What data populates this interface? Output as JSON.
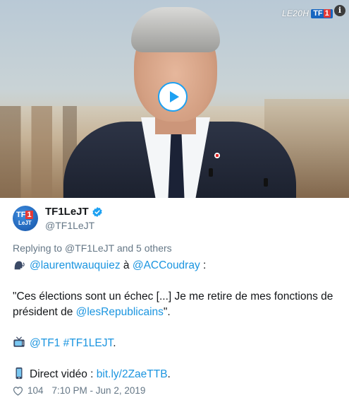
{
  "media": {
    "tv_show_label": "LE20H",
    "tv_brand_prefix": "TF",
    "tv_brand_one": "1",
    "info_label": "i",
    "play_icon": "play-icon",
    "accent": "#1da1f2"
  },
  "avatar": {
    "top_text": "TF",
    "one_text": "1",
    "bottom_text": "LeJT"
  },
  "author": {
    "display_name": "TF1LeJT",
    "handle": "@TF1LeJT",
    "verified_icon": "verified-badge-icon"
  },
  "reply": {
    "prefix": "Replying to",
    "to_handle": "@TF1LeJT",
    "others": "and 5 others"
  },
  "tweet": {
    "line1": {
      "emoji": "speaking-head-icon",
      "mention1": "@laurentwauquiez",
      "connector": " à ",
      "mention2": "@ACCoudray",
      "suffix": " :"
    },
    "quote": {
      "part1": "\"Ces élections sont un échec [...] Je me retire de mes fonctions de président de ",
      "mention": "@lesRepublicains",
      "part2": "\"."
    },
    "tv_line": {
      "emoji": "television-icon",
      "mention": "@TF1",
      "hashtag": "#TF1LEJT",
      "suffix": "."
    },
    "video_line": {
      "emoji": "mobile-phone-icon",
      "label": "Direct vidéo : ",
      "link": "bit.ly/2ZaeTTB",
      "suffix": "."
    }
  },
  "footer": {
    "likes": "104",
    "timestamp": "7:10 PM - Jun 2, 2019"
  },
  "colors": {
    "link": "#1b95e0",
    "secondary": "#657786",
    "text": "#14171a"
  }
}
